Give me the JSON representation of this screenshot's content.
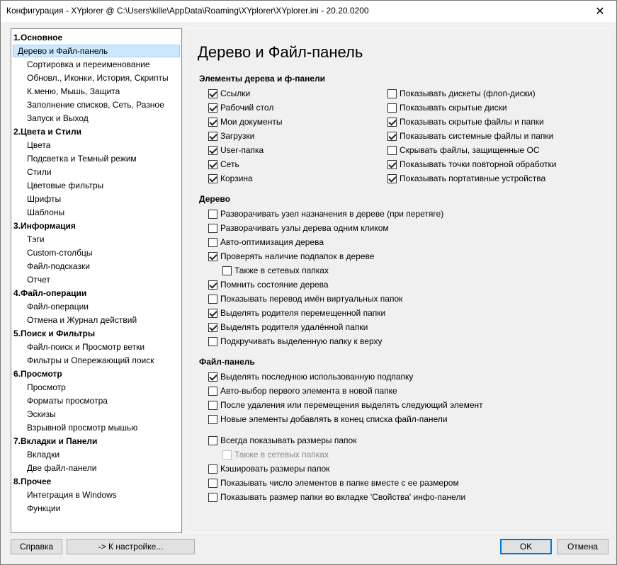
{
  "window": {
    "title": "Конфигурация - XYplorer @ C:\\Users\\kille\\AppData\\Roaming\\XYplorer\\XYplorer.ini - 20.20.0200",
    "close_glyph": "✕"
  },
  "nav": [
    {
      "label": "1.Основное",
      "type": "cat"
    },
    {
      "label": "Дерево и Файл-панель",
      "type": "sub",
      "selected": true
    },
    {
      "label": "Сортировка и переименование",
      "type": "sub"
    },
    {
      "label": "Обновл., Иконки, История, Скрипты",
      "type": "sub"
    },
    {
      "label": "К.меню, Мышь, Защита",
      "type": "sub"
    },
    {
      "label": "Заполнение списков, Сеть, Разное",
      "type": "sub"
    },
    {
      "label": "Запуск и Выход",
      "type": "sub"
    },
    {
      "label": "2.Цвета и Стили",
      "type": "cat"
    },
    {
      "label": "Цвета",
      "type": "sub"
    },
    {
      "label": "Подсветка и Темный режим",
      "type": "sub"
    },
    {
      "label": "Стили",
      "type": "sub"
    },
    {
      "label": "Цветовые фильтры",
      "type": "sub"
    },
    {
      "label": "Шрифты",
      "type": "sub"
    },
    {
      "label": "Шаблоны",
      "type": "sub"
    },
    {
      "label": "3.Информация",
      "type": "cat"
    },
    {
      "label": "Тэги",
      "type": "sub"
    },
    {
      "label": "Custom-столбцы",
      "type": "sub"
    },
    {
      "label": "Файл-подсказки",
      "type": "sub"
    },
    {
      "label": "Отчет",
      "type": "sub"
    },
    {
      "label": "4.Файл-операции",
      "type": "cat"
    },
    {
      "label": "Файл-операции",
      "type": "sub"
    },
    {
      "label": "Отмена и Журнал действий",
      "type": "sub"
    },
    {
      "label": "5.Поиск и Фильтры",
      "type": "cat"
    },
    {
      "label": "Файл-поиск и Просмотр ветки",
      "type": "sub"
    },
    {
      "label": "Фильтры и Опережающий поиск",
      "type": "sub"
    },
    {
      "label": "6.Просмотр",
      "type": "cat"
    },
    {
      "label": "Просмотр",
      "type": "sub"
    },
    {
      "label": "Форматы просмотра",
      "type": "sub"
    },
    {
      "label": "Эскизы",
      "type": "sub"
    },
    {
      "label": "Взрывной просмотр мышью",
      "type": "sub"
    },
    {
      "label": "7.Вкладки и Панели",
      "type": "cat"
    },
    {
      "label": "Вкладки",
      "type": "sub"
    },
    {
      "label": "Две файл-панели",
      "type": "sub"
    },
    {
      "label": "8.Прочее",
      "type": "cat"
    },
    {
      "label": "Интеграция в Windows",
      "type": "sub"
    },
    {
      "label": "Функции",
      "type": "sub"
    }
  ],
  "panel": {
    "title": "Дерево и Файл-панель",
    "sections": {
      "elements": "Элементы дерева и ф-панели",
      "tree": "Дерево",
      "filepanel": "Файл-панель"
    },
    "elements_left": [
      {
        "label": "Ссылки",
        "checked": true
      },
      {
        "label": "Рабочий стол",
        "checked": true
      },
      {
        "label": "Мои документы",
        "checked": true
      },
      {
        "label": "Загрузки",
        "checked": true
      },
      {
        "label": "User-папка",
        "checked": true
      },
      {
        "label": "Сеть",
        "checked": true
      },
      {
        "label": "Корзина",
        "checked": true
      }
    ],
    "elements_right": [
      {
        "label": "Показывать дискеты (флоп-диски)",
        "checked": false
      },
      {
        "label": "Показывать скрытые диски",
        "checked": false
      },
      {
        "label": "Показывать скрытые файлы и папки",
        "checked": true
      },
      {
        "label": "Показывать системные файлы и папки",
        "checked": true
      },
      {
        "label": "Скрывать файлы, защищенные ОС",
        "checked": false
      },
      {
        "label": "Показывать точки повторной обработки",
        "checked": true
      },
      {
        "label": "Показывать портативные устройства",
        "checked": true
      }
    ],
    "tree_options": [
      {
        "label": "Разворачивать узел назначения в дереве (при перетяге)",
        "checked": false
      },
      {
        "label": "Разворачивать узлы дерева одним кликом",
        "checked": false
      },
      {
        "label": "Авто-оптимизация дерева",
        "checked": false
      },
      {
        "label": "Проверять наличие подпапок в дереве",
        "checked": true
      },
      {
        "label": "Также в сетевых папках",
        "checked": false,
        "indent": true
      },
      {
        "label": "Помнить состояние дерева",
        "checked": true
      },
      {
        "label": "Показывать перевод имён виртуальных папок",
        "checked": false
      },
      {
        "label": "Выделять родителя перемещенной папки",
        "checked": true
      },
      {
        "label": "Выделять родителя удалённой папки",
        "checked": true
      },
      {
        "label": "Подкручивать выделенную папку к верху",
        "checked": false
      }
    ],
    "filepanel_options": [
      {
        "label": "Выделять последнюю использованную подпапку",
        "checked": true
      },
      {
        "label": "Авто-выбор первого элемента в новой папке",
        "checked": false
      },
      {
        "label": "После удаления или перемещения выделять следующий элемент",
        "checked": false
      },
      {
        "label": "Новые элементы добавлять в конец списка файл-панели",
        "checked": false
      }
    ],
    "size_options": [
      {
        "label": "Всегда показывать размеры папок",
        "checked": false
      },
      {
        "label": "Также в сетевых папках",
        "checked": false,
        "indent": true,
        "disabled": true
      },
      {
        "label": "Кэшировать размеры папок",
        "checked": false
      },
      {
        "label": "Показывать число элементов в папке вместе с ее размером",
        "checked": false
      },
      {
        "label": "Показывать размер папки во вкладке 'Свойства' инфо-панели",
        "checked": false
      }
    ]
  },
  "buttons": {
    "help": "Справка",
    "goto": "-> К настройке...",
    "ok": "OK",
    "cancel": "Отмена"
  }
}
